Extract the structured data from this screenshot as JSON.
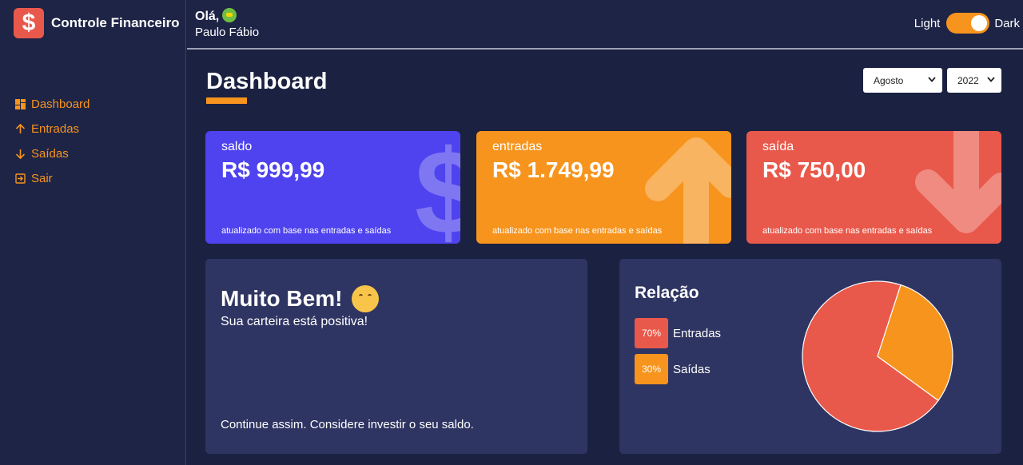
{
  "brand": {
    "title": "Controle Financeiro",
    "logo_symbol": "$",
    "logo_color": "#e9594b"
  },
  "sidebar": {
    "items": [
      {
        "label": "Dashboard",
        "icon": "dashboard-icon"
      },
      {
        "label": "Entradas",
        "icon": "arrow-up-icon"
      },
      {
        "label": "Saídas",
        "icon": "arrow-down-icon"
      },
      {
        "label": "Sair",
        "icon": "logout-icon"
      }
    ],
    "accent": "#f7941d"
  },
  "header": {
    "greeting": "Olá,",
    "greeting_emoji": "money-face-emoji",
    "username": "Paulo Fábio",
    "theme_light_label": "Light",
    "theme_dark_label": "Dark",
    "theme_is_dark": true
  },
  "main": {
    "title": "Dashboard",
    "month": "Agosto",
    "year": "2022"
  },
  "cards": {
    "balance": {
      "label": "saldo",
      "value": "R$ 999,99",
      "note": "atualizado com base nas entradas e saídas",
      "color": "#4e43ee",
      "icon": "dollar-icon"
    },
    "income": {
      "label": "entradas",
      "value": "R$ 1.749,99",
      "note": "atualizado com base nas entradas e saídas",
      "color": "#f7941d",
      "icon": "arrow-up-icon"
    },
    "expense": {
      "label": "saída",
      "value": "R$ 750,00",
      "note": "atualizado com base nas entradas e saídas",
      "color": "#e9594b",
      "icon": "arrow-down-icon"
    }
  },
  "message": {
    "title": "Muito Bem!",
    "emoji": "hugging-face-emoji",
    "subtitle": "Sua carteira está positiva!",
    "footer": "Continue assim. Considere investir o seu saldo."
  },
  "relation": {
    "title": "Relação",
    "items": [
      {
        "percent_label": "70%",
        "label": "Entradas",
        "value": 70,
        "color": "#e9594b"
      },
      {
        "percent_label": "30%",
        "label": "Saídas",
        "value": 30,
        "color": "#f7941d"
      }
    ]
  }
}
